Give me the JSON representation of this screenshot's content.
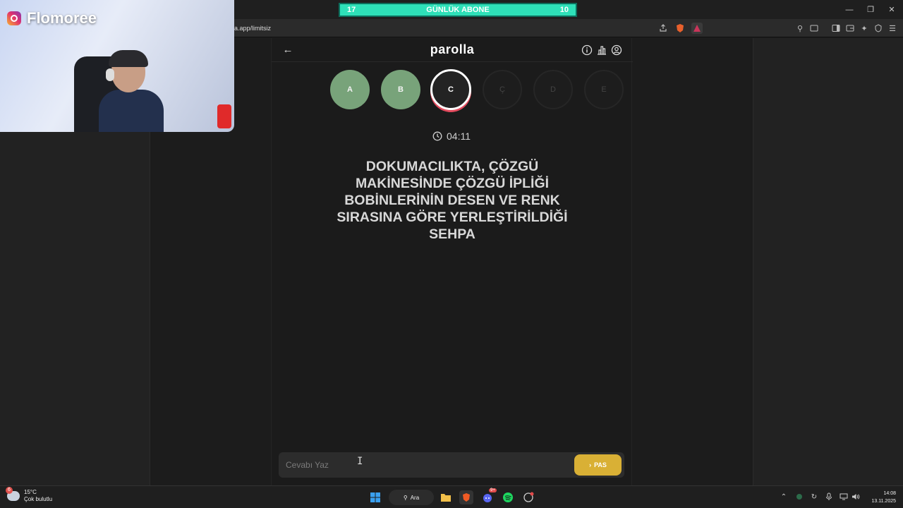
{
  "browser": {
    "url": "a.app/limitsiz",
    "window_controls": [
      "minimize",
      "restore",
      "close"
    ]
  },
  "overlay": {
    "subscriber_goal": {
      "current": "17",
      "label": "GÜNLÜK ABONE",
      "target": "10"
    },
    "streamer_handle": "Flomoree"
  },
  "app": {
    "logo": "parolla",
    "letters": [
      {
        "letter": "A",
        "state": "done"
      },
      {
        "letter": "B",
        "state": "done"
      },
      {
        "letter": "C",
        "state": "current"
      },
      {
        "letter": "Ç",
        "state": "pending"
      },
      {
        "letter": "D",
        "state": "pending"
      },
      {
        "letter": "E",
        "state": "pending"
      }
    ],
    "timer": "04:11",
    "question": "DOKUMACILIKTA, ÇÖZGÜ MAKİNESİNDE ÇÖZGÜ İPLİĞİ BOBİNLERİNİN DESEN VE RENK SIRASINA GÖRE YERLEŞTİRİLDİĞİ SEHPA",
    "answer_placeholder": "Cevabı Yaz",
    "pass_label": "PAS",
    "colors": {
      "done": "#78a37a",
      "current_ring": "#e24a5d",
      "pass": "#d9b035",
      "goal_bar": "#2ee0b8"
    }
  },
  "taskbar": {
    "weather_temp": "15°C",
    "weather_desc": "Çok bulutlu",
    "weather_badge": "6",
    "search_label": "Ara",
    "discord_badge": "9+",
    "time": "14:08",
    "date": "13.11.2025"
  }
}
